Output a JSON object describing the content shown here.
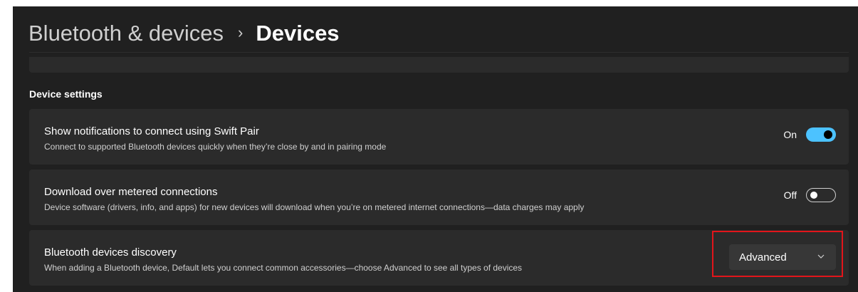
{
  "breadcrumb": {
    "parent": "Bluetooth & devices",
    "separator": "›",
    "current": "Devices"
  },
  "device_settings": {
    "section_title": "Device settings",
    "swift_pair": {
      "title": "Show notifications to connect using Swift Pair",
      "description": "Connect to supported Bluetooth devices quickly when they’re close by and in pairing mode",
      "state_label": "On",
      "enabled": true
    },
    "metered": {
      "title": "Download over metered connections",
      "description": "Device software (drivers, info, and apps) for new devices will download when you’re on metered internet connections—data charges may apply",
      "state_label": "Off",
      "enabled": false
    },
    "discovery": {
      "title": "Bluetooth devices discovery",
      "description": "When adding a Bluetooth device, Default lets you connect common accessories—choose Advanced to see all types of devices",
      "selected_value": "Advanced",
      "highlight_color": "#e2151b"
    }
  },
  "colors": {
    "accent": "#4cc2ff",
    "background": "#202020",
    "card": "#2b2b2b"
  },
  "icons": {
    "breadcrumb_separator": "chevron-right-icon",
    "dropdown": "chevron-down-icon"
  }
}
